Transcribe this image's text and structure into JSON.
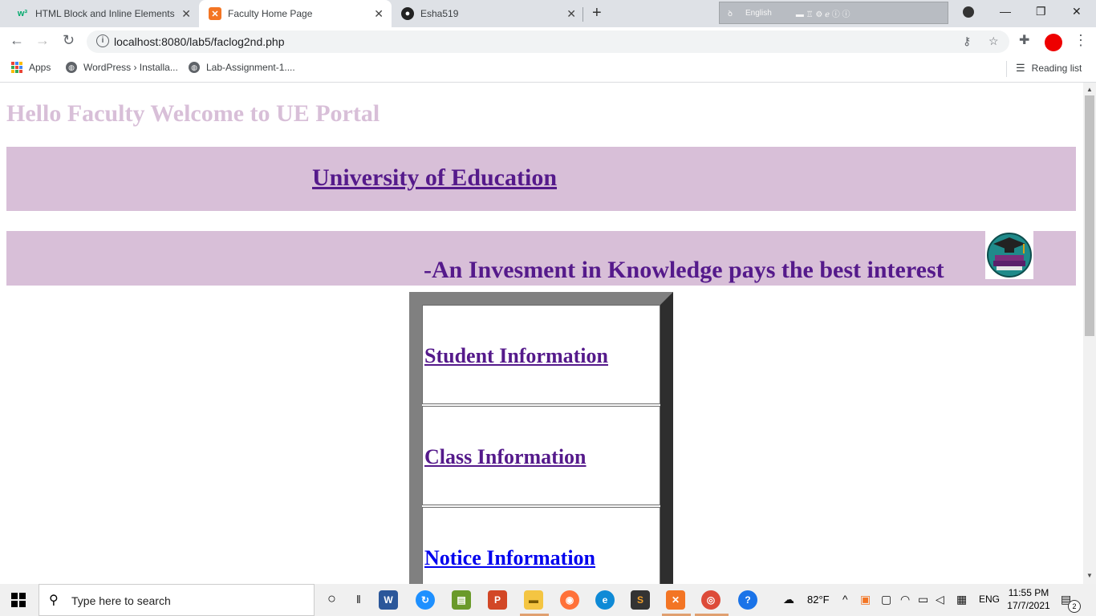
{
  "browser": {
    "tabs": [
      {
        "title": "HTML Block and Inline Elements",
        "favicon": "w3schools-icon",
        "active": false
      },
      {
        "title": "Faculty Home Page",
        "favicon": "xampp-icon",
        "active": true
      },
      {
        "title": "Esha519",
        "favicon": "github-icon",
        "active": false
      }
    ],
    "ime_language": "English",
    "url": "localhost:8080/lab5/faclog2nd.php",
    "bookmarks": [
      "Apps",
      "WordPress › Installa...",
      "Lab-Assignment-1...."
    ],
    "reading_list": "Reading list"
  },
  "page": {
    "welcome": "Hello Faculty Welcome to UE Portal",
    "university": "University of Education",
    "slogan": "-An Invesment in Knowledge pays the best interest",
    "menu": [
      {
        "label": "Student Information",
        "color": "#551a8b"
      },
      {
        "label": "Class Information",
        "color": "#551a8b"
      },
      {
        "label": "Notice Information",
        "color": "#0000ee"
      }
    ]
  },
  "taskbar": {
    "search_placeholder": "Type here to search",
    "temperature": "82°F",
    "language": "ENG",
    "time": "11:55 PM",
    "date": "17/7/2021",
    "notification_count": "2"
  },
  "colors": {
    "banner": "#d8bfd8",
    "visited_link": "#551a8b",
    "link": "#0000ee"
  }
}
